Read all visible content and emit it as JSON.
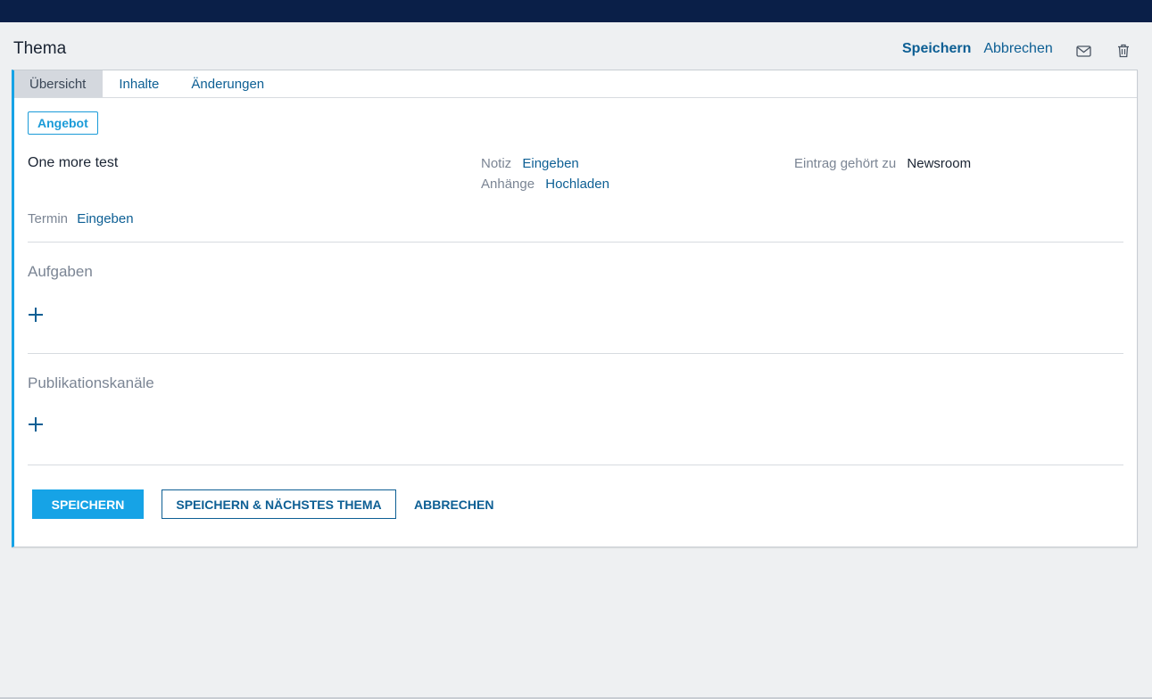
{
  "header": {
    "title": "Thema",
    "save_label": "Speichern",
    "cancel_label": "Abbrechen",
    "icons": [
      "mail-icon",
      "trash-icon"
    ]
  },
  "tabs": [
    {
      "label": "Übersicht",
      "active": true
    },
    {
      "label": "Inhalte",
      "active": false
    },
    {
      "label": "Änderungen",
      "active": false
    }
  ],
  "detail": {
    "badge": "Angebot",
    "title": "One more test",
    "note_label": "Notiz",
    "note_action": "Eingeben",
    "attachments_label": "Anhänge",
    "attachments_action": "Hochladen",
    "owner_label": "Eintrag gehört zu",
    "owner_value": "Newsroom",
    "date_label": "Termin",
    "date_action": "Eingeben"
  },
  "sections": {
    "tasks_title": "Aufgaben",
    "channels_title": "Publikationskanäle"
  },
  "footer": {
    "save_label": "SPEICHERN",
    "save_next_label": "SPEICHERN & NÄCHSTES THEMA",
    "cancel_label": "ABBRECHEN"
  },
  "colors": {
    "topbar": "#0a1f48",
    "accent": "#16a3e6",
    "link": "#0d5f94"
  }
}
